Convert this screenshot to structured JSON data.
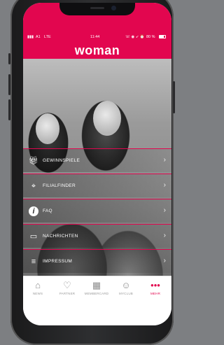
{
  "app": {
    "brand": "woman"
  },
  "status_bar": {
    "carrier": "A1",
    "network": "LTE",
    "time": "11:44",
    "battery": "80 %"
  },
  "menu": {
    "items": [
      {
        "label": "GEWINNSPIELE",
        "icon": "gift-icon"
      },
      {
        "label": "FILIALFINDER",
        "icon": "location-pin-icon"
      },
      {
        "label": "FAQ",
        "icon": "info-icon"
      },
      {
        "label": "NACHRICHTEN",
        "icon": "message-icon"
      },
      {
        "label": "IMPRESSUM",
        "icon": "menu-lines-icon"
      }
    ]
  },
  "tabbar": {
    "tabs": [
      {
        "label": "NEWS",
        "icon": "home-icon"
      },
      {
        "label": "PARTNER",
        "icon": "heart-icon"
      },
      {
        "label": "MEMBERCARD",
        "icon": "qr-code-icon"
      },
      {
        "label": "MYCLUB",
        "icon": "smiley-icon"
      },
      {
        "label": "MEHR",
        "icon": "more-dots-icon",
        "active": true
      }
    ]
  },
  "colors": {
    "accent": "#e2064f",
    "background": "#7d7f82"
  }
}
